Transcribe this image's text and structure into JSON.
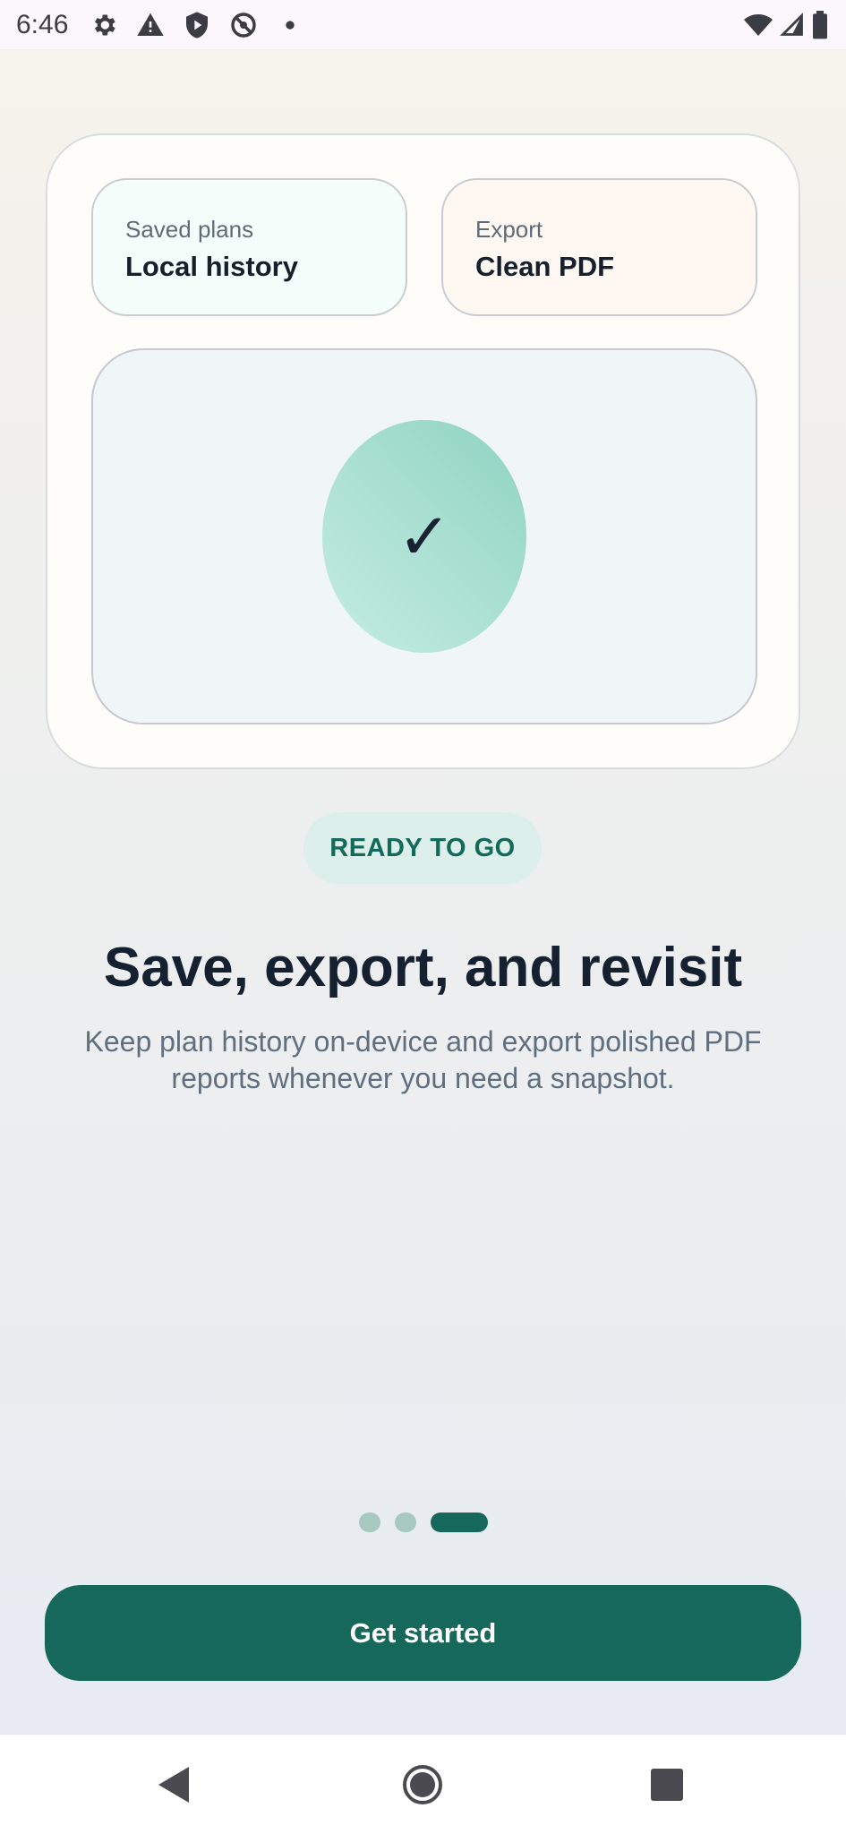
{
  "status_bar": {
    "time": "6:46",
    "icons_left": [
      "gear-icon",
      "warning-icon",
      "shield-icon",
      "no-sync-icon",
      "dot-icon"
    ],
    "icons_right": [
      "wifi-icon",
      "signal-icon",
      "battery-icon"
    ]
  },
  "card": {
    "tiles": [
      {
        "label": "Saved plans",
        "value": "Local history"
      },
      {
        "label": "Export",
        "value": "Clean PDF"
      }
    ],
    "check_glyph": "✓"
  },
  "badge": {
    "label": "READY TO GO"
  },
  "headline": "Save, export, and revisit",
  "description": "Keep plan history on-device and export polished PDF reports whenever you need a snapshot.",
  "pager": {
    "count": 3,
    "active": 3
  },
  "cta": {
    "label": "Get started"
  },
  "colors": {
    "accent": "#15685a",
    "badge_bg": "#dcefea",
    "check_gradient": [
      "#c6ede2",
      "#8fd3c2"
    ],
    "headline": "#152030",
    "body_text": "#5f6f7f"
  },
  "nav_bar": {
    "buttons": [
      "back-icon",
      "home-icon",
      "recents-icon"
    ]
  }
}
